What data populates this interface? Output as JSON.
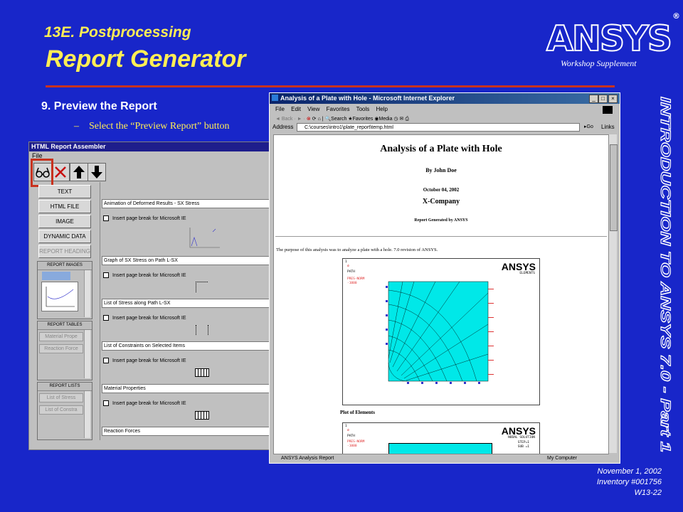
{
  "slide": {
    "subtitle": "13E. Postprocessing",
    "title": "Report Generator",
    "logo": "ANSYS",
    "logo_mark": "®",
    "supplement": "Workshop Supplement",
    "step": "9.  Preview the Report",
    "bullet_dash": "–",
    "bullet": "Select the “Preview Report” button",
    "vertical": "INTRODUCTION TO ANSYS 7.0 - Part 1",
    "footer": [
      "November 1, 2002",
      "Inventory #001756",
      "W13-22"
    ]
  },
  "assembler": {
    "title": "HTML Report Assembler",
    "menu": "File",
    "left_buttons": [
      "TEXT",
      "HTML FILE",
      "IMAGE",
      "DYNAMIC DATA",
      "REPORT HEADING"
    ],
    "groups": {
      "images": "REPORT IMAGES",
      "tables": "REPORT TABLES",
      "lists": "REPORT LISTS"
    },
    "table_items": [
      "Material Prope",
      "Reaction Force"
    ],
    "list_items": [
      "List of Stress",
      "List of Constra"
    ],
    "items": [
      "Animation of Deformed Results - SX Stress",
      "Graph of SX Stress on Path L-SX",
      "List of Stress along Path L-SX",
      "List of Constraints on Selected Items",
      "Material Properties",
      "Reaction Forces"
    ],
    "checkbox_label": "Insert page break for Microsoft IE"
  },
  "browser": {
    "title": "Analysis of a Plate with Hole - Microsoft Internet Explorer",
    "menu": [
      "File",
      "Edit",
      "View",
      "Favorites",
      "Tools",
      "Help"
    ],
    "toolbar": [
      "Back",
      "Search",
      "Favorites",
      "Media"
    ],
    "address_label": "Address",
    "address": "C:\\courses\\intro1\\plate_report\\temp.html",
    "go": "Go",
    "links": "Links",
    "status_left": "ANSYS Analysis Report",
    "status_right": "My Computer",
    "doc": {
      "heading": "Analysis of a Plate with Hole",
      "author": "By John Doe",
      "date": "October 04, 2002",
      "company": "X-Company",
      "generated": "Report Generated by ANSYS",
      "intro": "The purpose of this analysis was to analyze a plate with a hole. 7.0 revision of ANSYS.",
      "plot_caption": "Plot of Elements",
      "plot1": {
        "logo": "ANSYS",
        "label": "ELEMENTS",
        "path": "PATH",
        "pres": "PRES-NORM",
        "pres_val": "-1000",
        "num": "1",
        "sigma": "σ"
      },
      "plot2": {
        "logo": "ANSYS",
        "label": "NODAL SOLUTION",
        "path": "PATH",
        "pres": "PRES-NORM",
        "pres_val": "-1000",
        "num": "1",
        "sigma": "σ",
        "step": "STEP=1",
        "sub": "SUB =1"
      }
    }
  },
  "colors": {
    "background": "#1826c9",
    "title": "#ffee55",
    "accent": "#c8321e",
    "mesh": "#00e8e8"
  }
}
